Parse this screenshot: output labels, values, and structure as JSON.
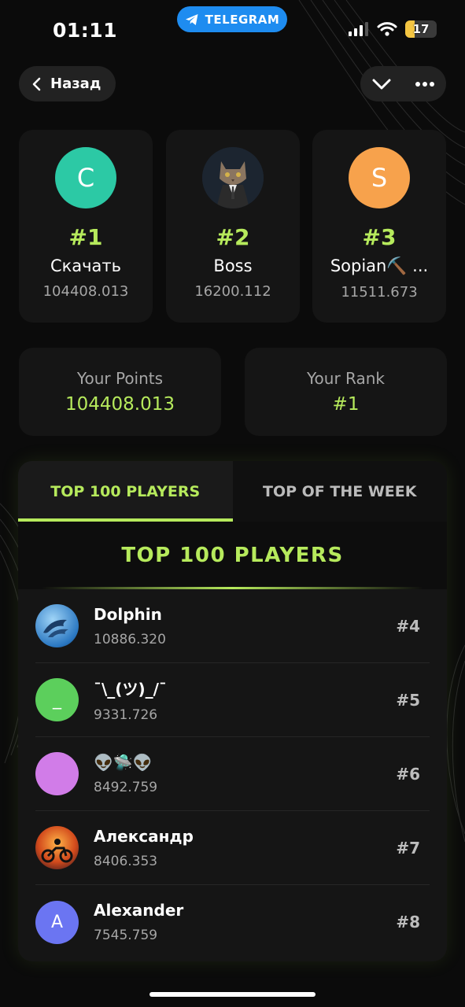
{
  "status_bar": {
    "time": "01:11",
    "telegram_label": "TELEGRAM",
    "battery": "17"
  },
  "nav": {
    "back_label": "Назад"
  },
  "podium": [
    {
      "rank": "#1",
      "name": "Скачать",
      "score": "104408.013",
      "initial": "C",
      "avatar_color": "#2cc9a5"
    },
    {
      "rank": "#2",
      "name": "Boss",
      "score": "16200.112",
      "initial": "",
      "avatar_color": "#4a4a4a"
    },
    {
      "rank": "#3",
      "name": "Sopian⛏️ ...",
      "score": "11511.673",
      "initial": "S",
      "avatar_color": "#f7a24c"
    }
  ],
  "stats": {
    "points_label": "Your Points",
    "points_value": "104408.013",
    "rank_label": "Your Rank",
    "rank_value": "#1"
  },
  "board": {
    "tabs": [
      "TOP 100 PLAYERS",
      "TOP OF THE WEEK"
    ],
    "active_tab": 0,
    "title": "TOP 100 PLAYERS",
    "rows": [
      {
        "name": "Dolphin",
        "score": "10886.320",
        "rank": "#4",
        "initial": "",
        "avatar_color": "#3d8fd6"
      },
      {
        "name": "¯\\_(ツ)_/¯",
        "score": "9331.726",
        "rank": "#5",
        "initial": "_",
        "avatar_color": "#5ccf5c"
      },
      {
        "name": "👽🛸👽",
        "score": "8492.759",
        "rank": "#6",
        "initial": "",
        "avatar_color": "#d17ce8"
      },
      {
        "name": "Александр",
        "score": "8406.353",
        "rank": "#7",
        "initial": "",
        "avatar_color": "#c0442c"
      },
      {
        "name": "Alexander",
        "score": "7545.759",
        "rank": "#8",
        "initial": "A",
        "avatar_color": "#6b75f2"
      }
    ]
  },
  "colors": {
    "accent": "#b6ea5c",
    "card": "#151515",
    "background": "#0b0b0b"
  }
}
